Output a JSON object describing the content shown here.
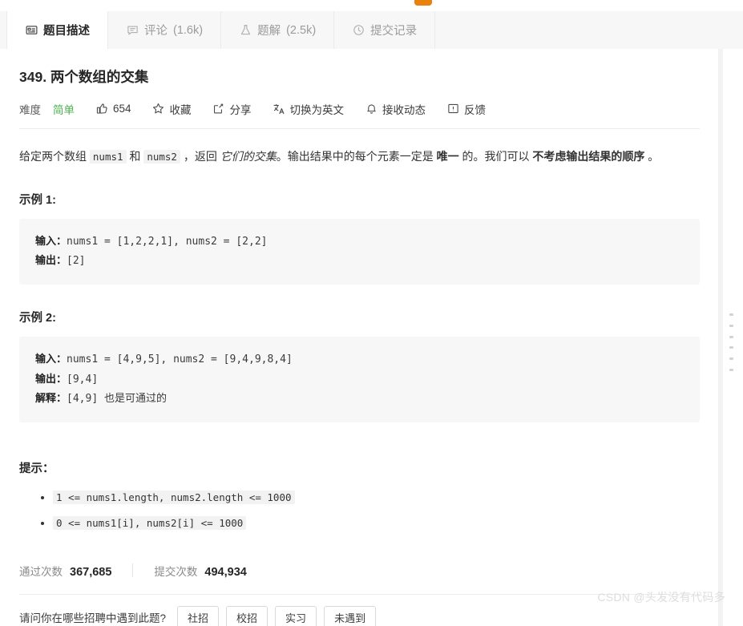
{
  "window": {
    "watermark": "CSDN @头发没有代码多"
  },
  "tabs": [
    {
      "label": "题目描述",
      "count": "",
      "icon": "description-icon",
      "active": true
    },
    {
      "label": "评论",
      "count": "(1.6k)",
      "icon": "comment-icon",
      "active": false
    },
    {
      "label": "题解",
      "count": "(2.5k)",
      "icon": "flask-icon",
      "active": false
    },
    {
      "label": "提交记录",
      "count": "",
      "icon": "clock-icon",
      "active": false
    }
  ],
  "problem": {
    "title": "349. 两个数组的交集",
    "difficulty_label": "难度",
    "difficulty_value": "简单",
    "difficulty_color": "#4caf50",
    "likes": "654",
    "favorite_label": "收藏",
    "share_label": "分享",
    "translate_label": "切换为英文",
    "subscribe_label": "接收动态",
    "feedback_label": "反馈",
    "description": {
      "part1": "给定两个数组 ",
      "code1": "nums1",
      "part2": " 和 ",
      "code2": "nums2",
      "part3": " ，返回 ",
      "italic1": "它们的交集",
      "part4": "。输出结果中的每个元素一定是 ",
      "bold1": "唯一",
      "part5": " 的。我们可以 ",
      "bold2": "不考虑输出结果的顺序",
      "part6": " 。"
    },
    "examples": [
      {
        "heading": "示例 1:",
        "lines": [
          {
            "label": "输入：",
            "value": "nums1 = [1,2,2,1], nums2 = [2,2]"
          },
          {
            "label": "输出：",
            "value": "[2]"
          }
        ]
      },
      {
        "heading": "示例 2:",
        "lines": [
          {
            "label": "输入：",
            "value": "nums1 = [4,9,5], nums2 = [9,4,9,8,4]"
          },
          {
            "label": "输出：",
            "value": "[9,4]"
          },
          {
            "label": "解释：",
            "value": "[4,9] 也是可通过的"
          }
        ]
      }
    ],
    "hints_heading": "提示：",
    "hints": [
      "1 <= nums1.length, nums2.length <= 1000",
      "0 <= nums1[i], nums2[i] <= 1000"
    ],
    "stats": {
      "accepted_label": "通过次数",
      "accepted_value": "367,685",
      "submissions_label": "提交次数",
      "submissions_value": "494,934"
    },
    "poll": {
      "question": "请问你在哪些招聘中遇到此题?",
      "options": [
        "社招",
        "校招",
        "实习",
        "未遇到"
      ]
    }
  }
}
